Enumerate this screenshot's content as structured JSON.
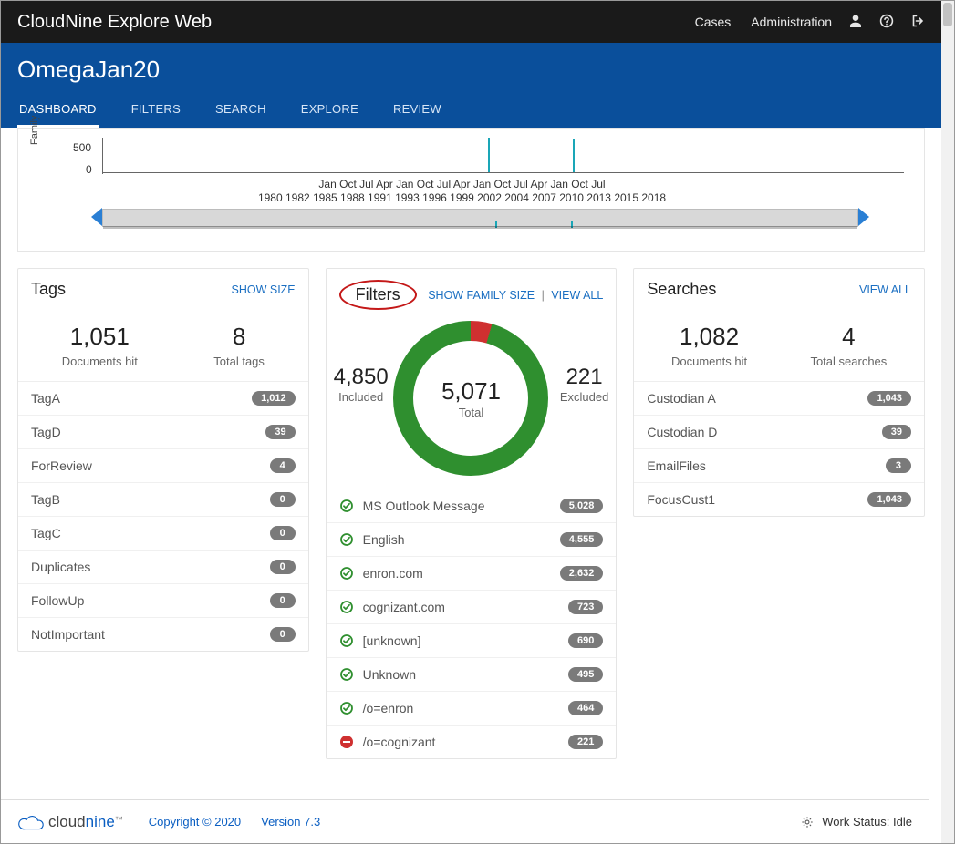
{
  "topbar": {
    "brand": "CloudNine Explore Web",
    "links": {
      "cases": "Cases",
      "admin": "Administration"
    }
  },
  "case": {
    "title": "OmegaJan20"
  },
  "tabs": {
    "dashboard": "DASHBOARD",
    "filters": "FILTERS",
    "search": "SEARCH",
    "explore": "EXPLORE",
    "review": "REVIEW"
  },
  "timeline": {
    "yaxis_label": "Family",
    "tick_500": "500",
    "tick_0": "0",
    "months": "Jan   Oct   Jul   Apr   Jan   Oct   Jul   Apr   Jan   Oct   Jul   Apr   Jan   Oct   Jul",
    "years": "1980 1982 1985 1988 1991 1993 1996 1999 2002 2004 2007 2010 2013 2015 2018"
  },
  "tagsPanel": {
    "title": "Tags",
    "show_size": "SHOW SIZE",
    "docs_val": "1,051",
    "docs_lbl": "Documents hit",
    "total_val": "8",
    "total_lbl": "Total tags",
    "items": [
      {
        "label": "TagA",
        "count": "1,012"
      },
      {
        "label": "TagD",
        "count": "39"
      },
      {
        "label": "ForReview",
        "count": "4"
      },
      {
        "label": "TagB",
        "count": "0"
      },
      {
        "label": "TagC",
        "count": "0"
      },
      {
        "label": "Duplicates",
        "count": "0"
      },
      {
        "label": "FollowUp",
        "count": "0"
      },
      {
        "label": "NotImportant",
        "count": "0"
      }
    ]
  },
  "filtersPanel": {
    "title": "Filters",
    "show_family": "SHOW FAMILY SIZE",
    "view_all": "VIEW ALL",
    "included_val": "4,850",
    "included_lbl": "Included",
    "total_val": "5,071",
    "total_lbl": "Total",
    "excluded_val": "221",
    "excluded_lbl": "Excluded",
    "items": [
      {
        "label": "MS Outlook Message",
        "count": "5,028",
        "state": "include"
      },
      {
        "label": "English",
        "count": "4,555",
        "state": "include"
      },
      {
        "label": "enron.com",
        "count": "2,632",
        "state": "include"
      },
      {
        "label": "cognizant.com",
        "count": "723",
        "state": "include"
      },
      {
        "label": "[unknown]",
        "count": "690",
        "state": "include"
      },
      {
        "label": "Unknown",
        "count": "495",
        "state": "include"
      },
      {
        "label": "/o=enron",
        "count": "464",
        "state": "include"
      },
      {
        "label": "/o=cognizant",
        "count": "221",
        "state": "exclude"
      }
    ]
  },
  "searchesPanel": {
    "title": "Searches",
    "view_all": "VIEW ALL",
    "docs_val": "1,082",
    "docs_lbl": "Documents hit",
    "total_val": "4",
    "total_lbl": "Total searches",
    "items": [
      {
        "label": "Custodian A",
        "count": "1,043"
      },
      {
        "label": "Custodian D",
        "count": "39"
      },
      {
        "label": "EmailFiles",
        "count": "3"
      },
      {
        "label": "FocusCust1",
        "count": "1,043"
      }
    ]
  },
  "footer": {
    "copyright": "Copyright © 2020",
    "version": "Version 7.3",
    "status": "Work Status: Idle",
    "logo_a": "cloud",
    "logo_b": "nine"
  }
}
